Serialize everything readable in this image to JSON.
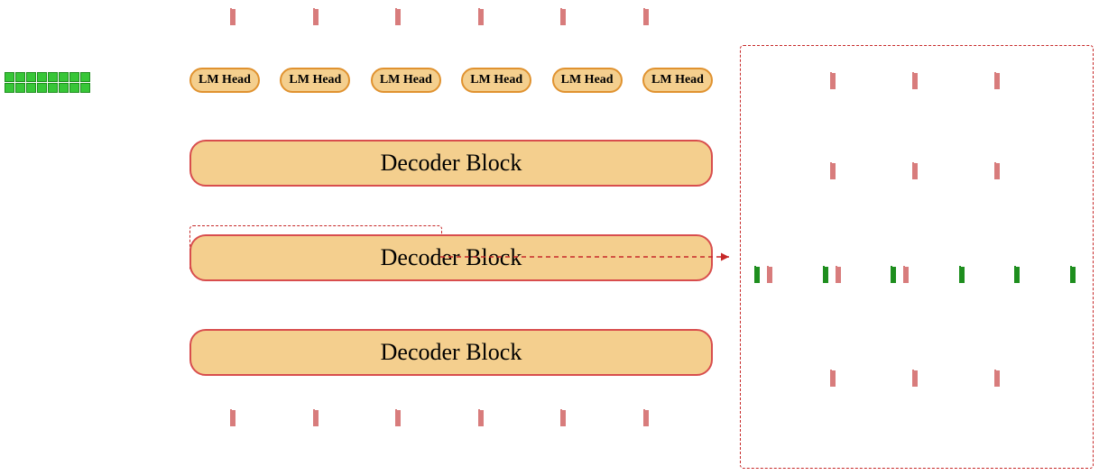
{
  "lm_head_label": "LM Head",
  "decoder_label": "Decoder Block",
  "lm_head_count": 6,
  "top_token_count": 6,
  "bottom_token_count": 6,
  "decoder_block_count": 3,
  "green_prefix": {
    "rows": 2,
    "cols": 8
  },
  "right_panel": {
    "rows": [
      {
        "kind": "out3",
        "count": 3
      },
      {
        "kind": "out3",
        "count": 3
      },
      {
        "kind": "attn6",
        "pairs": 3,
        "extra_green": 3
      },
      {
        "kind": "out3",
        "count": 3
      }
    ]
  }
}
